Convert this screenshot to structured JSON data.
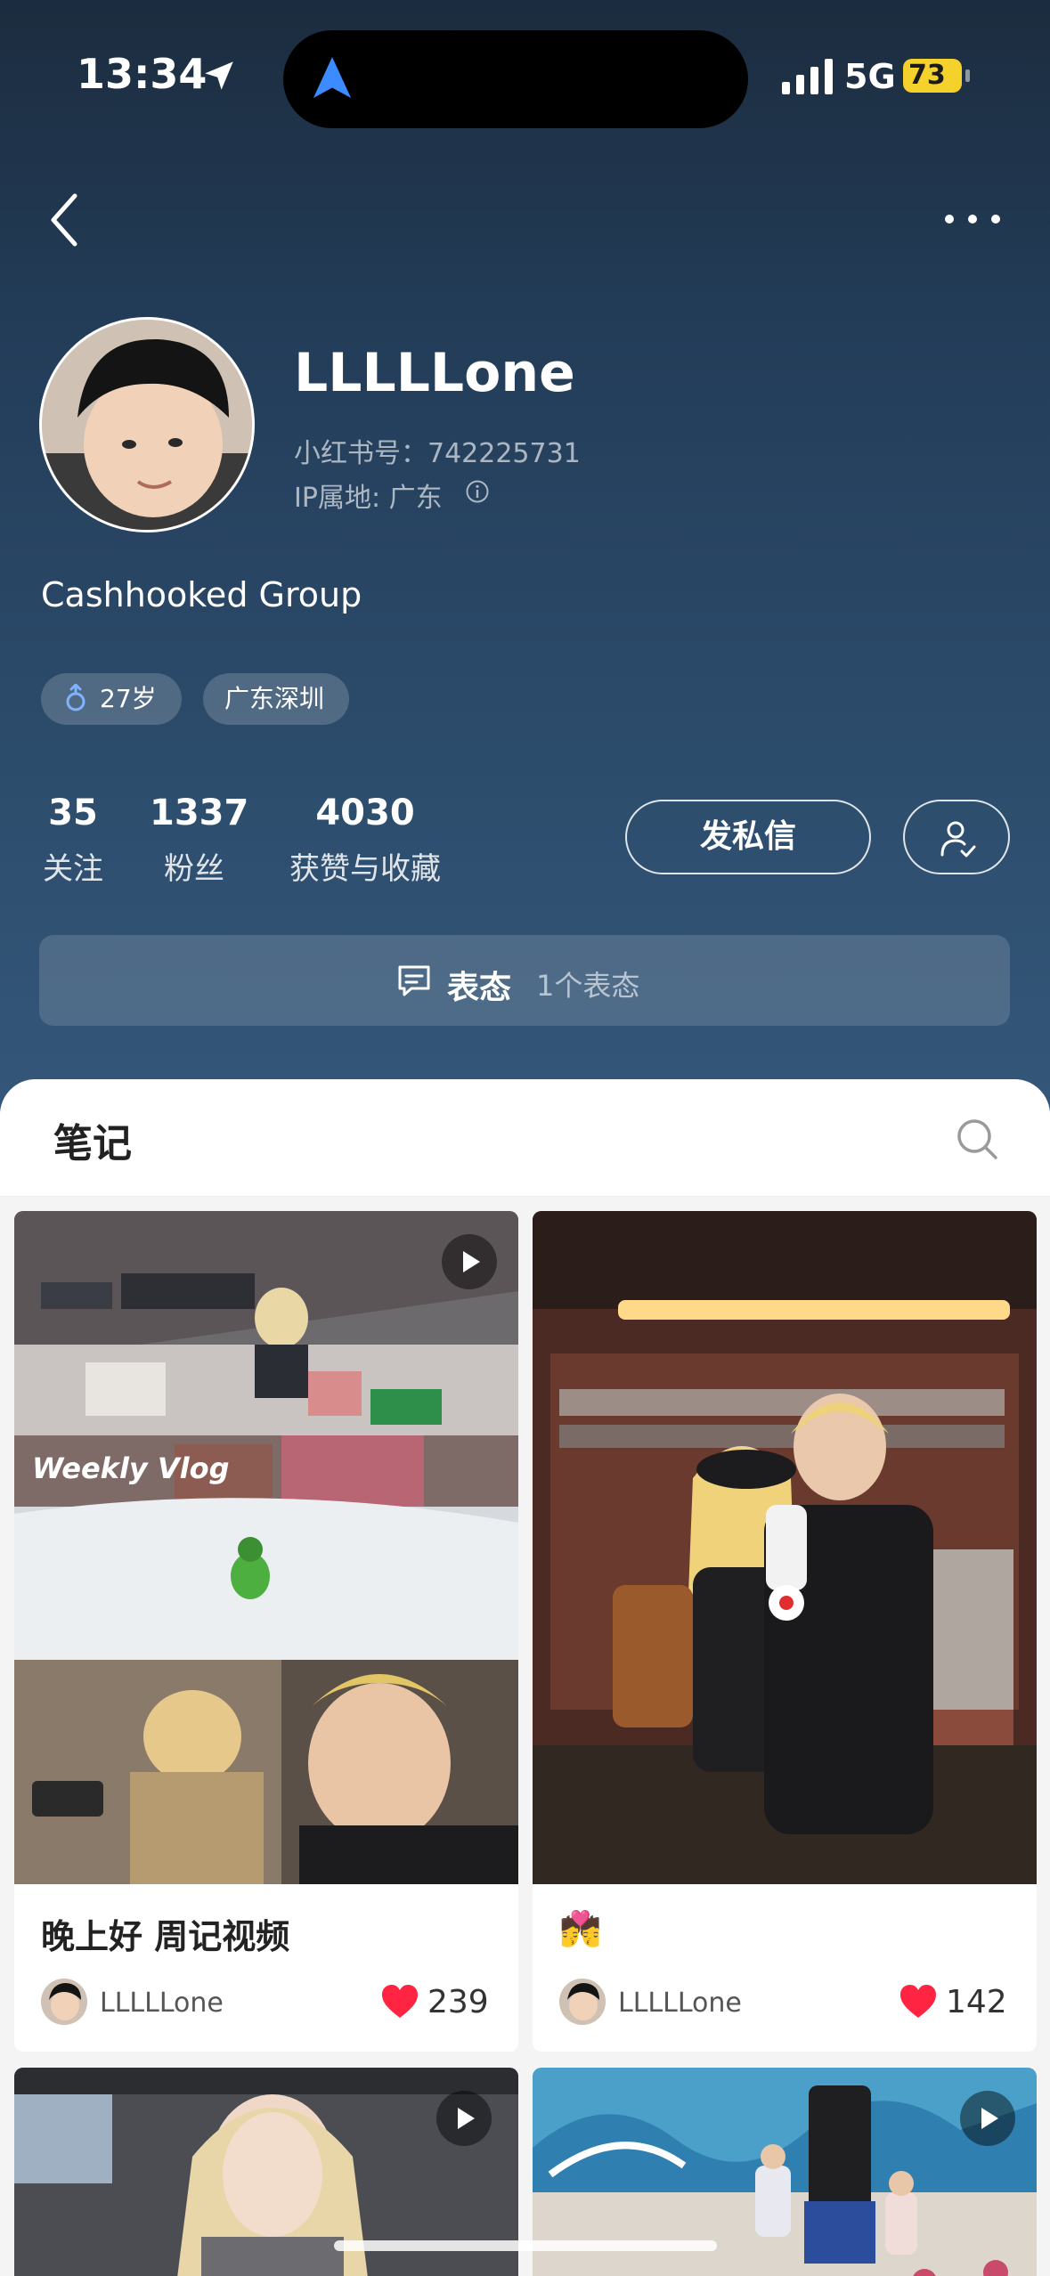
{
  "status_bar": {
    "time": "13:34",
    "network": "5G",
    "battery": "73"
  },
  "profile": {
    "username": "LLLLLone",
    "red_id": "小红书号：742225731",
    "ip_location": "IP属地: 广东",
    "bio": "Cashhooked Group",
    "tags": {
      "age": "27岁",
      "location": "广东深圳"
    },
    "stats": {
      "following_count": "35",
      "following_label": "关注",
      "fans_count": "1337",
      "fans_label": "粉丝",
      "likes_count": "4030",
      "likes_label": "获赞与收藏"
    },
    "message_button": "发私信",
    "reaction": {
      "title": "表态",
      "count": "1个表态"
    }
  },
  "notes_tab": {
    "label": "笔记"
  },
  "notes": [
    {
      "title": "晚上好 周记视频",
      "overlay_text": "Weekly Vlog",
      "author": "LLLLLone",
      "likes": "239",
      "is_video": true
    },
    {
      "title": "💏",
      "author": "LLLLLone",
      "likes": "142",
      "is_video": false
    },
    {
      "is_video": true
    },
    {
      "is_video": true
    }
  ],
  "colors": {
    "header_top": "#1c2c3f",
    "header_bottom": "#34577a",
    "like_red": "#ff2442",
    "battery_yellow": "#f4d12b"
  }
}
